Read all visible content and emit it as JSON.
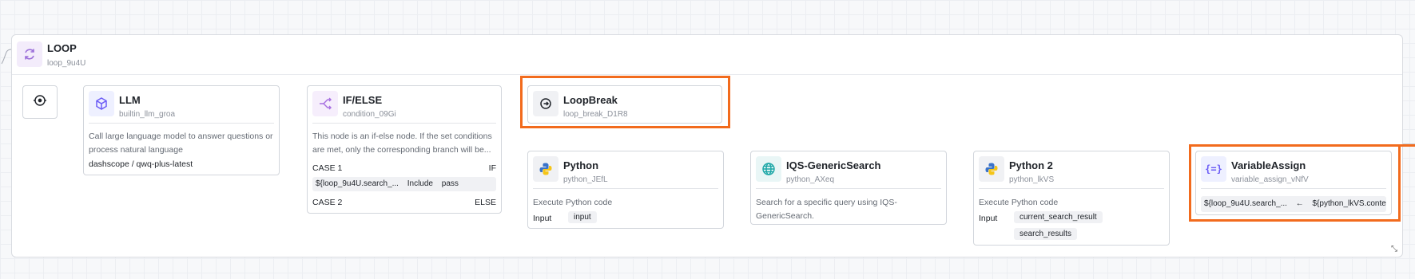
{
  "loop": {
    "title": "LOOP",
    "id": "loop_9u4U"
  },
  "nodes": {
    "llm": {
      "title": "LLM",
      "id": "builtin_llm_groa",
      "description": "Call large language model to answer questions or process natural language",
      "model": "dashscope / qwq-plus-latest"
    },
    "ifelse": {
      "title": "IF/ELSE",
      "id": "condition_09Gi",
      "description": "This node is an if-else node. If the set conditions are met, only the corresponding branch will be...",
      "case1_label": "CASE 1",
      "case1_branch": "IF",
      "case1_var": "${loop_9u4U.search_...",
      "case1_op": "Include",
      "case1_value": "pass",
      "case2_label": "CASE 2",
      "case2_branch": "ELSE"
    },
    "loopbreak": {
      "title": "LoopBreak",
      "id": "loop_break_D1R8"
    },
    "python": {
      "title": "Python",
      "id": "python_JEfL",
      "description": "Execute Python code",
      "input_label": "Input",
      "input_value": "input"
    },
    "iqs": {
      "title": "IQS-GenericSearch",
      "id": "python_AXeq",
      "description": "Search for a specific query using IQS-GenericSearch."
    },
    "python2": {
      "title": "Python 2",
      "id": "python_lkVS",
      "description": "Execute Python code",
      "input_label": "Input",
      "input_value1": "current_search_result",
      "input_value2": "search_results"
    },
    "varassign": {
      "title": "VariableAssign",
      "id": "variable_assign_vNfV",
      "assign_left": "${loop_9u4U.search_...",
      "assign_arrow": "←",
      "assign_right": "${python_lkVS.conte..."
    }
  },
  "colors": {
    "highlight": "#f26b1d",
    "llm_icon_bg": "#eef0ff",
    "llm_icon": "#6b5cf6",
    "loop_icon": "#9b6fd9",
    "python_yellow": "#f5c518",
    "python_blue": "#3a73c9",
    "globe": "#1aa6a6"
  },
  "icons": {
    "start": "loop-start-icon",
    "loop": "loop-arrows-icon",
    "llm": "cube-icon",
    "ifelse": "branch-icon",
    "loopbreak": "loop-break-icon",
    "python": "python-icon",
    "iqs": "globe-icon",
    "varassign": "braces-equals-icon",
    "resize": "resize-icon"
  }
}
